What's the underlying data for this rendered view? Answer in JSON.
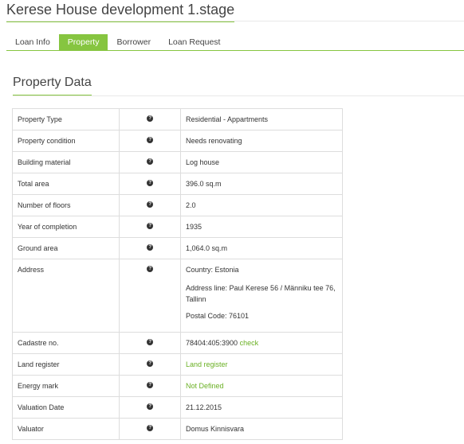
{
  "page": {
    "title": "Kerese House development 1.stage"
  },
  "tabs": [
    {
      "label": "Loan Info",
      "active": false
    },
    {
      "label": "Property",
      "active": true
    },
    {
      "label": "Borrower",
      "active": false
    },
    {
      "label": "Loan Request",
      "active": false
    }
  ],
  "section": {
    "title": "Property Data"
  },
  "rows": {
    "property_type": {
      "label": "Property Type",
      "value": "Residential - Appartments"
    },
    "property_condition": {
      "label": "Property condition",
      "value": "Needs renovating"
    },
    "building_material": {
      "label": "Building material",
      "value": "Log house"
    },
    "total_area": {
      "label": "Total area",
      "value": "396.0 sq.m"
    },
    "floors": {
      "label": "Number of floors",
      "value": "2.0"
    },
    "year": {
      "label": "Year of completion",
      "value": "1935"
    },
    "ground_area": {
      "label": "Ground area",
      "value": "1,064.0 sq.m"
    },
    "address": {
      "label": "Address",
      "country": "Country: Estonia",
      "line": "Address line: Paul Kerese 56 / Männiku tee 76, Tallinn",
      "postal": "Postal Code: 76101"
    },
    "cadastre": {
      "label": "Cadastre no.",
      "value": "78404:405:3900",
      "link": "check"
    },
    "land_register": {
      "label": "Land register",
      "value": "Land register"
    },
    "energy_mark": {
      "label": "Energy mark",
      "value": "Not Defined"
    },
    "valuation_date": {
      "label": "Valuation Date",
      "value": "21.12.2015"
    },
    "valuator": {
      "label": "Valuator",
      "value": "Domus Kinnisvara"
    }
  },
  "help_icon": "question-circle-icon",
  "colors": {
    "accent": "#86c540",
    "link": "#6ab023"
  }
}
